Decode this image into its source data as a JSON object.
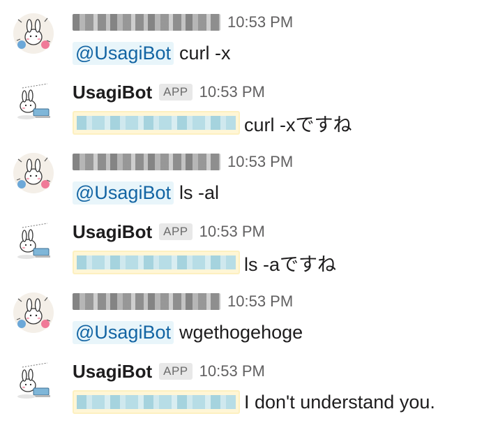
{
  "messages": [
    {
      "author_type": "user",
      "time": "10:53 PM",
      "mention": "@UsagiBot",
      "text": "curl -x"
    },
    {
      "author_type": "bot",
      "author": "UsagiBot",
      "badge": "APP",
      "time": "10:53 PM",
      "text": "curl -xですね"
    },
    {
      "author_type": "user",
      "time": "10:53 PM",
      "mention": "@UsagiBot",
      "text": "ls -al"
    },
    {
      "author_type": "bot",
      "author": "UsagiBot",
      "badge": "APP",
      "time": "10:53 PM",
      "text": "ls -aですね"
    },
    {
      "author_type": "user",
      "time": "10:53 PM",
      "mention": "@UsagiBot",
      "text": "wgethogehoge"
    },
    {
      "author_type": "bot",
      "author": "UsagiBot",
      "badge": "APP",
      "time": "10:53 PM",
      "text": "I don't understand you."
    }
  ]
}
